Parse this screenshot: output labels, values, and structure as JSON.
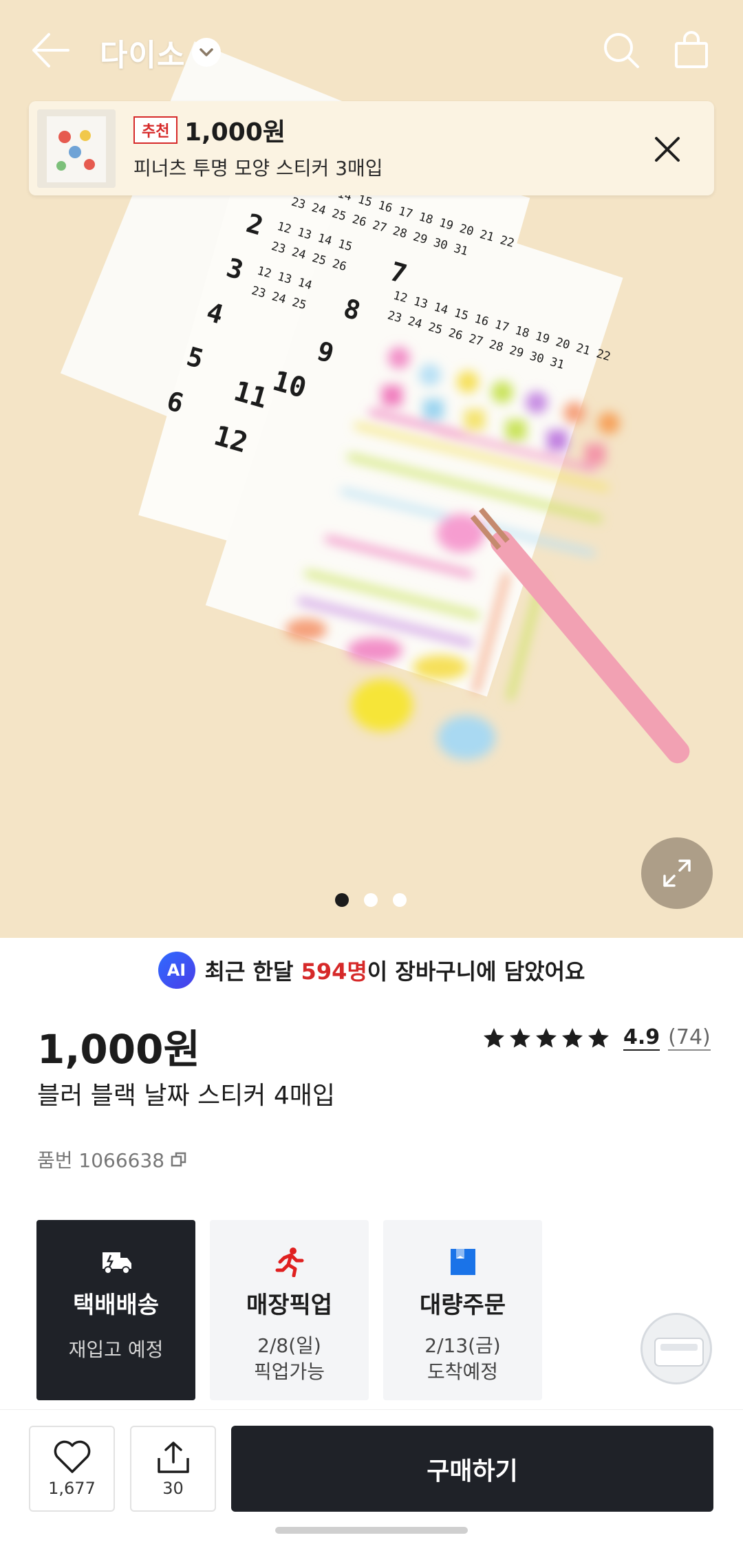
{
  "header": {
    "brand": "다이소",
    "back_icon": "arrow-left-icon",
    "search_icon": "search-icon",
    "cart_icon": "shopping-bag-icon"
  },
  "recommendation": {
    "badge": "추천",
    "price": "1,000원",
    "name": "피너츠 투명 모양 스티커 3매입"
  },
  "gallery": {
    "page_count": 3,
    "active_index": 0
  },
  "ai_banner": {
    "badge": "AI",
    "prefix": "최근 한달 ",
    "highlight": "594명",
    "suffix": "이 장바구니에 담았어요"
  },
  "product": {
    "price": "1,000원",
    "title": "블러 블랙 날짜 스티커 4매입",
    "sku": "품번 1066638",
    "rating_value": "4.9",
    "rating_count": "(74)",
    "stars": 5
  },
  "delivery": [
    {
      "title": "택배배송",
      "line1": "재입고 예정",
      "line2": ""
    },
    {
      "title": "매장픽업",
      "line1": "2/8(일)",
      "line2": "픽업가능"
    },
    {
      "title": "대량주문",
      "line1": "2/13(금)",
      "line2": "도착예정"
    }
  ],
  "bottom_bar": {
    "like_count": "1,677",
    "share_count": "30",
    "buy_label": "구매하기"
  },
  "colors": {
    "accent_red": "#d62929",
    "dark": "#1f2228",
    "ai_blue": "#2f6bff"
  }
}
